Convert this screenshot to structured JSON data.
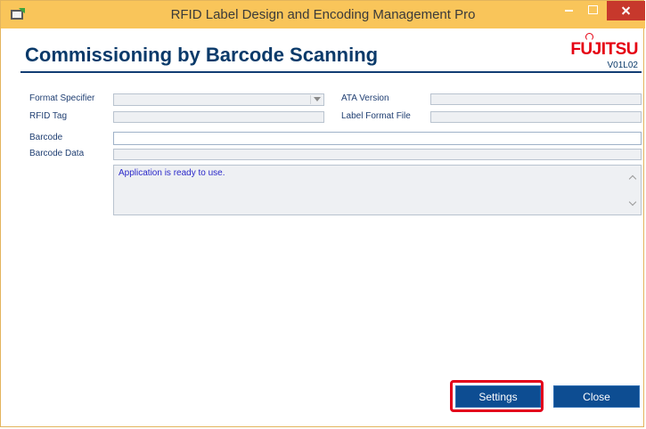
{
  "window": {
    "title": "RFID Label Design and Encoding Management Pro"
  },
  "header": {
    "title": "Commissioning by Barcode Scanning",
    "brand": "FUJITSU",
    "version": "V01L02"
  },
  "form": {
    "format_specifier": {
      "label": "Format Specifier",
      "value": ""
    },
    "ata_version": {
      "label": "ATA Version",
      "value": ""
    },
    "rfid_tag": {
      "label": "RFID Tag",
      "value": ""
    },
    "label_format_file": {
      "label": "Label Format File",
      "value": ""
    },
    "barcode": {
      "label": "Barcode",
      "value": ""
    },
    "barcode_data": {
      "label": "Barcode Data",
      "value": ""
    }
  },
  "status": {
    "message": "Application is ready to use."
  },
  "buttons": {
    "settings": "Settings",
    "close": "Close"
  },
  "colors": {
    "titlebar": "#f9c55a",
    "primary": "#0d4d92",
    "highlight": "#e3001b",
    "brand_red": "#e50012"
  }
}
